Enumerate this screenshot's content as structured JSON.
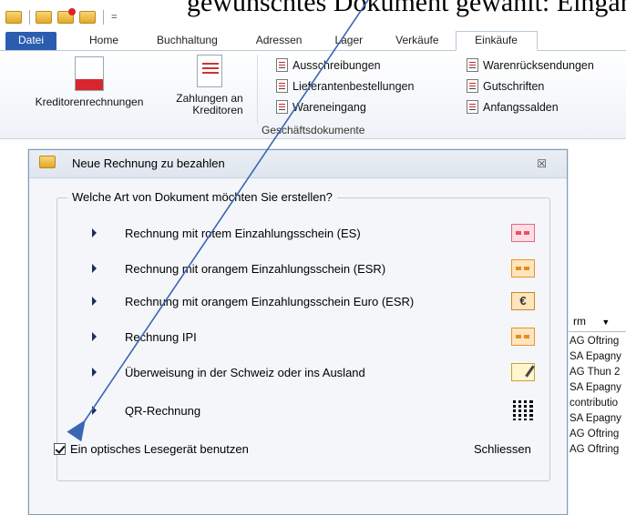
{
  "caption_fragment": "gewünschtes Dokument gewählt: Eingang",
  "qat": {
    "icons": [
      "app-icon",
      "open-folder-icon",
      "new-folder-icon",
      "folder-up-icon"
    ],
    "dropdown_glyph": "="
  },
  "tabs": [
    {
      "label": "Datei",
      "active": false
    },
    {
      "label": "Home",
      "active": false
    },
    {
      "label": "Buchhaltung",
      "active": false
    },
    {
      "label": "Adressen",
      "active": false
    },
    {
      "label": "Lager",
      "active": false
    },
    {
      "label": "Verkäufe",
      "active": false
    },
    {
      "label": "Einkäufe",
      "active": true
    }
  ],
  "ribbon": {
    "large_buttons": [
      {
        "label": "Kreditorenrechnungen",
        "icon": "invoice-icon"
      },
      {
        "label_line1": "Zahlungen an",
        "label_line2": "Kreditoren",
        "icon": "payment-doc-icon"
      }
    ],
    "small_buttons": [
      {
        "label": "Ausschreibungen"
      },
      {
        "label": "Lieferantenbestellungen"
      },
      {
        "label": "Wareneingang"
      },
      {
        "label": "Warenrücksendungen"
      },
      {
        "label": "Gutschriften"
      },
      {
        "label": "Anfangssalden"
      }
    ],
    "group_label": "Geschäftsdokumente"
  },
  "background_list": {
    "header": "rm",
    "rows": [
      "AG Oftring",
      "SA Epagny",
      "AG Thun 2",
      "SA Epagny",
      "contributio",
      "SA Epagny",
      "AG Oftring",
      "AG Oftring"
    ]
  },
  "dialog": {
    "title": "Neue Rechnung zu bezahlen",
    "close_glyph": "☒",
    "question": "Welche Art von Dokument möchten Sie erstellen?",
    "options": [
      {
        "label": "Rechnung mit rotem Einzahlungsschein (ES)",
        "icon": "red-slip-icon"
      },
      {
        "label": "Rechnung mit orangem Einzahlungsschein (ESR)",
        "icon": "orange-slip-icon"
      },
      {
        "label": "Rechnung mit orangem Einzahlungsschein Euro (ESR)",
        "icon": "euro-slip-icon",
        "icon_text": "€"
      },
      {
        "label": "Rechnung IPI",
        "icon": "ipi-slip-icon"
      },
      {
        "label": "Überweisung in der Schweiz oder ins Ausland",
        "icon": "transfer-slip-icon"
      },
      {
        "label": "QR-Rechnung",
        "icon": "qr-code-icon"
      }
    ],
    "checkbox_label": "Ein optisches Lesegerät benutzen",
    "checkbox_checked": true,
    "close_button": "Schliessen"
  },
  "colors": {
    "datei_tab": "#2a5db0",
    "annotation_arrow": "#3a66b5"
  }
}
